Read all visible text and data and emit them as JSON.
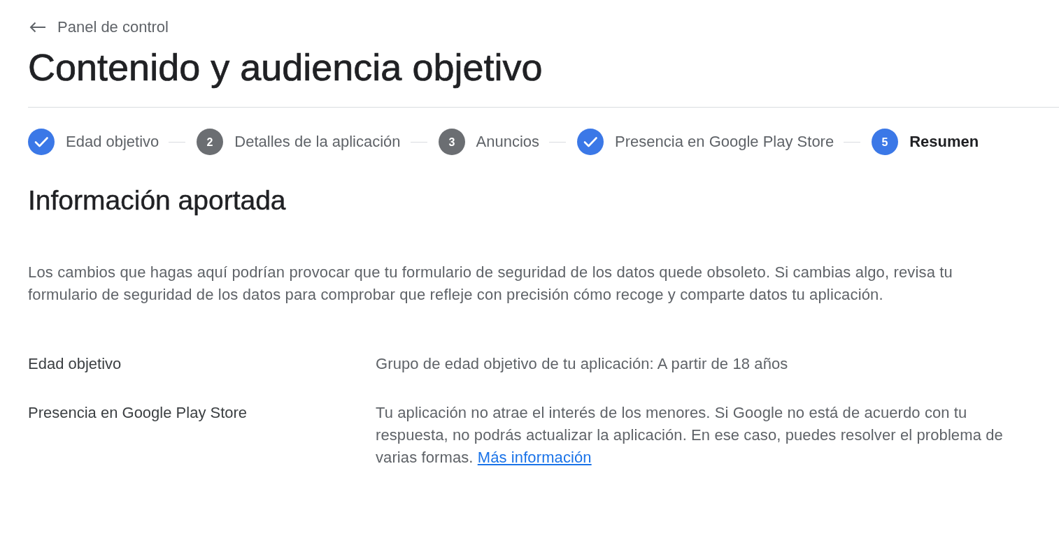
{
  "back_link": {
    "label": "Panel de control"
  },
  "title": "Contenido y audiencia objetivo",
  "steps": [
    {
      "label": "Edad objetivo",
      "completed": true,
      "selected": false
    },
    {
      "label": "Detalles de la aplicación",
      "number": "2",
      "completed": false,
      "selected": false
    },
    {
      "label": "Anuncios",
      "number": "3",
      "completed": false,
      "selected": false
    },
    {
      "label": "Presencia en Google Play Store",
      "completed": true,
      "selected": false
    },
    {
      "label": "Resumen",
      "number": "5",
      "completed": false,
      "selected": true
    }
  ],
  "section": {
    "heading": "Información aportada",
    "notice": "Los cambios que hagas aquí podrían provocar que tu formulario de seguridad de los datos quede obsoleto. Si cambias algo, revisa tu formulario de seguridad de los datos para comprobar que refleje con precisión cómo recoge y comparte datos tu aplicación.",
    "rows": [
      {
        "label": "Edad objetivo",
        "value": "Grupo de edad objetivo de tu aplicación: A partir de 18 años"
      },
      {
        "label": "Presencia en Google Play Store",
        "value": "Tu aplicación no atrae el interés de los menores. Si Google no está de acuerdo con tu respuesta, no podrás actualizar la aplicación. En ese caso, puedes resolver el problema de varias formas.",
        "link": "Más información"
      }
    ]
  }
}
